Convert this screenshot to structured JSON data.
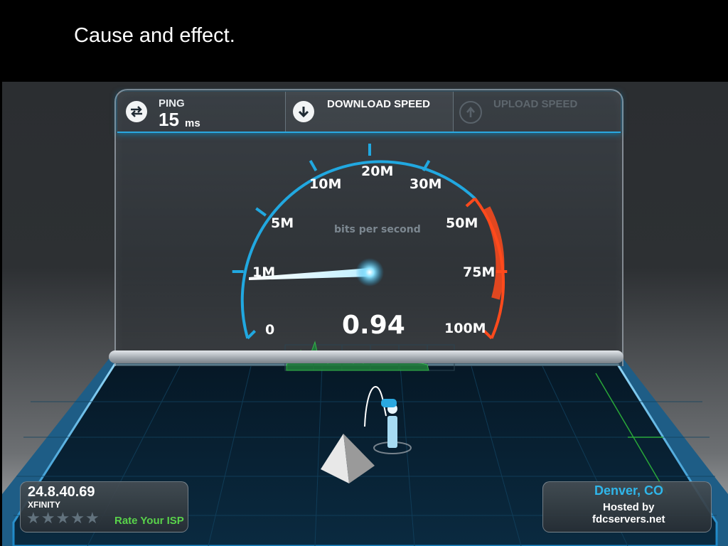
{
  "slide": {
    "title": "Cause and effect."
  },
  "header": {
    "ping": {
      "label": "PING",
      "value": "15",
      "unit": "ms",
      "icon": "arrows-exchange-icon"
    },
    "download": {
      "label": "DOWNLOAD SPEED",
      "icon": "download-arrow-icon"
    },
    "upload": {
      "label": "UPLOAD SPEED",
      "icon": "upload-arrow-icon"
    }
  },
  "gauge": {
    "unit_label": "bits per second",
    "reading": "0.94",
    "tick_labels": [
      "0",
      "1M",
      "5M",
      "10M",
      "20M",
      "30M",
      "50M",
      "75M",
      "100M"
    ],
    "accent_color": "#21a8e0",
    "warning_color": "#ff4a1c"
  },
  "location": {
    "ip": "24.8.40.69",
    "isp": "XFINITY",
    "rating_stars": 5,
    "rate_link": "Rate Your ISP",
    "city": "Denver, CO",
    "hosted_by": "Hosted by",
    "server": "fdcservers.net"
  }
}
